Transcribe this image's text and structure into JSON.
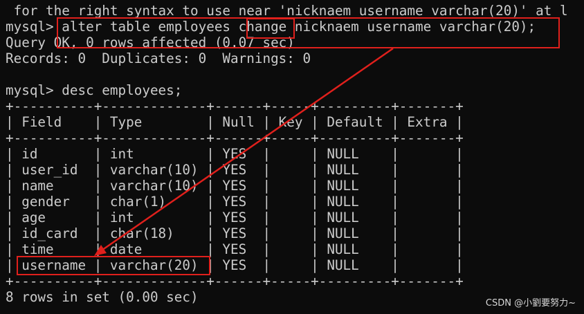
{
  "terminal": {
    "lines": [
      " for the right syntax to use near 'nicknaem username varchar(20)' at l",
      "mysql> alter table employees change nicknaem username varchar(20);",
      "Query OK, 0 rows affected (0.07 sec)",
      "Records: 0  Duplicates: 0  Warnings: 0",
      "",
      "mysql> desc employees;",
      "+----------+-------------+------+-----+---------+-------+",
      "| Field    | Type        | Null | Key | Default | Extra |",
      "+----------+-------------+------+-----+---------+-------+",
      "| id       | int         | YES  |     | NULL    |       |",
      "| user_id  | varchar(10) | YES  |     | NULL    |       |",
      "| name     | varchar(10) | YES  |     | NULL    |       |",
      "| gender   | char(1)     | YES  |     | NULL    |       |",
      "| age      | int         | YES  |     | NULL    |       |",
      "| id_card  | char(18)    | YES  |     | NULL    |       |",
      "| time     | date        | YES  |     | NULL    |       |",
      "| username | varchar(20) | YES  |     | NULL    |       |",
      "+----------+-------------+------+-----+---------+-------+",
      "8 rows in set (0.00 sec)"
    ]
  },
  "watermark": "CSDN @小劉要努力~",
  "colors": {
    "background": "#0c0c0c",
    "text": "#cccccc",
    "annotation": "#e0201c"
  }
}
